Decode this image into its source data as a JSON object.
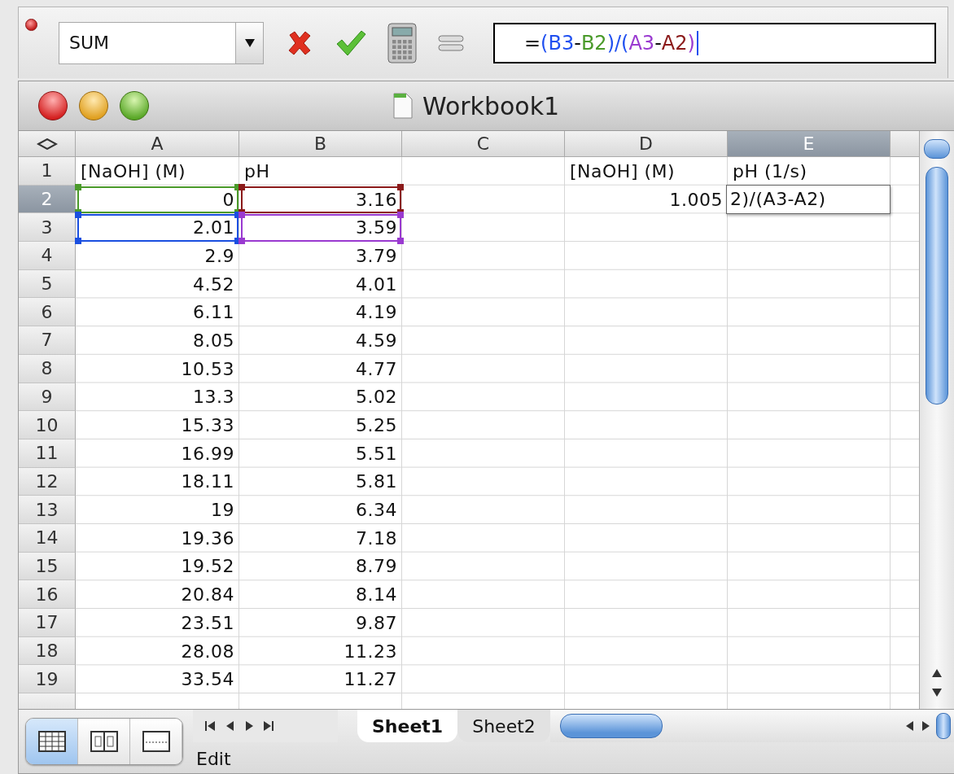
{
  "formula_bar": {
    "name_box": "SUM",
    "formula": [
      {
        "text": "=",
        "color": "#111111"
      },
      {
        "text": "(B3",
        "color": "#2050f0"
      },
      {
        "text": "-",
        "color": "#111111"
      },
      {
        "text": "B2",
        "color": "#4a9a2a"
      },
      {
        "text": ")/(",
        "color": "#2050f0"
      },
      {
        "text": "A3",
        "color": "#9a3ad0"
      },
      {
        "text": "-",
        "color": "#111111"
      },
      {
        "text": "A2",
        "color": "#8b1a1a"
      },
      {
        "text": ")",
        "color": "#9a3ad0"
      }
    ]
  },
  "window": {
    "title": "Workbook1"
  },
  "columns": [
    {
      "label": "A",
      "selected": false
    },
    {
      "label": "B",
      "selected": false
    },
    {
      "label": "C",
      "selected": false
    },
    {
      "label": "D",
      "selected": false
    },
    {
      "label": "E",
      "selected": true
    }
  ],
  "rows": [
    {
      "header": "1",
      "selected": false,
      "cells": [
        {
          "text": "[NaOH] (M)",
          "kind": "text"
        },
        {
          "text": "pH",
          "kind": "text"
        },
        null,
        {
          "text": "[NaOH] (M)",
          "kind": "text"
        },
        {
          "text": "pH (1/s)",
          "kind": "text"
        }
      ]
    },
    {
      "header": "2",
      "selected": true,
      "cells": [
        {
          "text": "0",
          "kind": "number",
          "color": "#4a9a2a"
        },
        {
          "text": "3.16",
          "kind": "number",
          "color": "#8b1a1a"
        },
        null,
        {
          "text": "1.005",
          "kind": "number"
        },
        {
          "text": "2)/(A3-A2)",
          "kind": "editor"
        }
      ]
    },
    {
      "header": "3",
      "selected": false,
      "cells": [
        {
          "text": "2.01",
          "kind": "number",
          "color": "#1a4fe0"
        },
        {
          "text": "3.59",
          "kind": "number",
          "color": "#9a3ad0"
        },
        null,
        null,
        null
      ]
    },
    {
      "header": "4",
      "selected": false,
      "cells": [
        {
          "text": "2.9",
          "kind": "number"
        },
        {
          "text": "3.79",
          "kind": "number"
        },
        null,
        null,
        null
      ]
    },
    {
      "header": "5",
      "selected": false,
      "cells": [
        {
          "text": "4.52",
          "kind": "number"
        },
        {
          "text": "4.01",
          "kind": "number"
        },
        null,
        null,
        null
      ]
    },
    {
      "header": "6",
      "selected": false,
      "cells": [
        {
          "text": "6.11",
          "kind": "number"
        },
        {
          "text": "4.19",
          "kind": "number"
        },
        null,
        null,
        null
      ]
    },
    {
      "header": "7",
      "selected": false,
      "cells": [
        {
          "text": "8.05",
          "kind": "number"
        },
        {
          "text": "4.59",
          "kind": "number"
        },
        null,
        null,
        null
      ]
    },
    {
      "header": "8",
      "selected": false,
      "cells": [
        {
          "text": "10.53",
          "kind": "number"
        },
        {
          "text": "4.77",
          "kind": "number"
        },
        null,
        null,
        null
      ]
    },
    {
      "header": "9",
      "selected": false,
      "cells": [
        {
          "text": "13.3",
          "kind": "number"
        },
        {
          "text": "5.02",
          "kind": "number"
        },
        null,
        null,
        null
      ]
    },
    {
      "header": "10",
      "selected": false,
      "cells": [
        {
          "text": "15.33",
          "kind": "number"
        },
        {
          "text": "5.25",
          "kind": "number"
        },
        null,
        null,
        null
      ]
    },
    {
      "header": "11",
      "selected": false,
      "cells": [
        {
          "text": "16.99",
          "kind": "number"
        },
        {
          "text": "5.51",
          "kind": "number"
        },
        null,
        null,
        null
      ]
    },
    {
      "header": "12",
      "selected": false,
      "cells": [
        {
          "text": "18.11",
          "kind": "number"
        },
        {
          "text": "5.81",
          "kind": "number"
        },
        null,
        null,
        null
      ]
    },
    {
      "header": "13",
      "selected": false,
      "cells": [
        {
          "text": "19",
          "kind": "number"
        },
        {
          "text": "6.34",
          "kind": "number"
        },
        null,
        null,
        null
      ]
    },
    {
      "header": "14",
      "selected": false,
      "cells": [
        {
          "text": "19.36",
          "kind": "number"
        },
        {
          "text": "7.18",
          "kind": "number"
        },
        null,
        null,
        null
      ]
    },
    {
      "header": "15",
      "selected": false,
      "cells": [
        {
          "text": "19.52",
          "kind": "number"
        },
        {
          "text": "8.79",
          "kind": "number"
        },
        null,
        null,
        null
      ]
    },
    {
      "header": "16",
      "selected": false,
      "cells": [
        {
          "text": "20.84",
          "kind": "number"
        },
        {
          "text": "8.14",
          "kind": "number"
        },
        null,
        null,
        null
      ]
    },
    {
      "header": "17",
      "selected": false,
      "cells": [
        {
          "text": "23.51",
          "kind": "number"
        },
        {
          "text": "9.87",
          "kind": "number"
        },
        null,
        null,
        null
      ]
    },
    {
      "header": "18",
      "selected": false,
      "cells": [
        {
          "text": "28.08",
          "kind": "number"
        },
        {
          "text": "11.23",
          "kind": "number"
        },
        null,
        null,
        null
      ]
    },
    {
      "header": "19",
      "selected": false,
      "cells": [
        {
          "text": "33.54",
          "kind": "number"
        },
        {
          "text": "11.27",
          "kind": "number"
        },
        null,
        null,
        null
      ]
    }
  ],
  "view_buttons": [
    {
      "selected": true
    },
    {
      "selected": false
    },
    {
      "selected": false
    }
  ],
  "sheet_tabs": [
    {
      "label": "Sheet1",
      "selected": true
    },
    {
      "label": "Sheet2",
      "selected": false
    }
  ],
  "status_bar": {
    "text": "Edit"
  }
}
